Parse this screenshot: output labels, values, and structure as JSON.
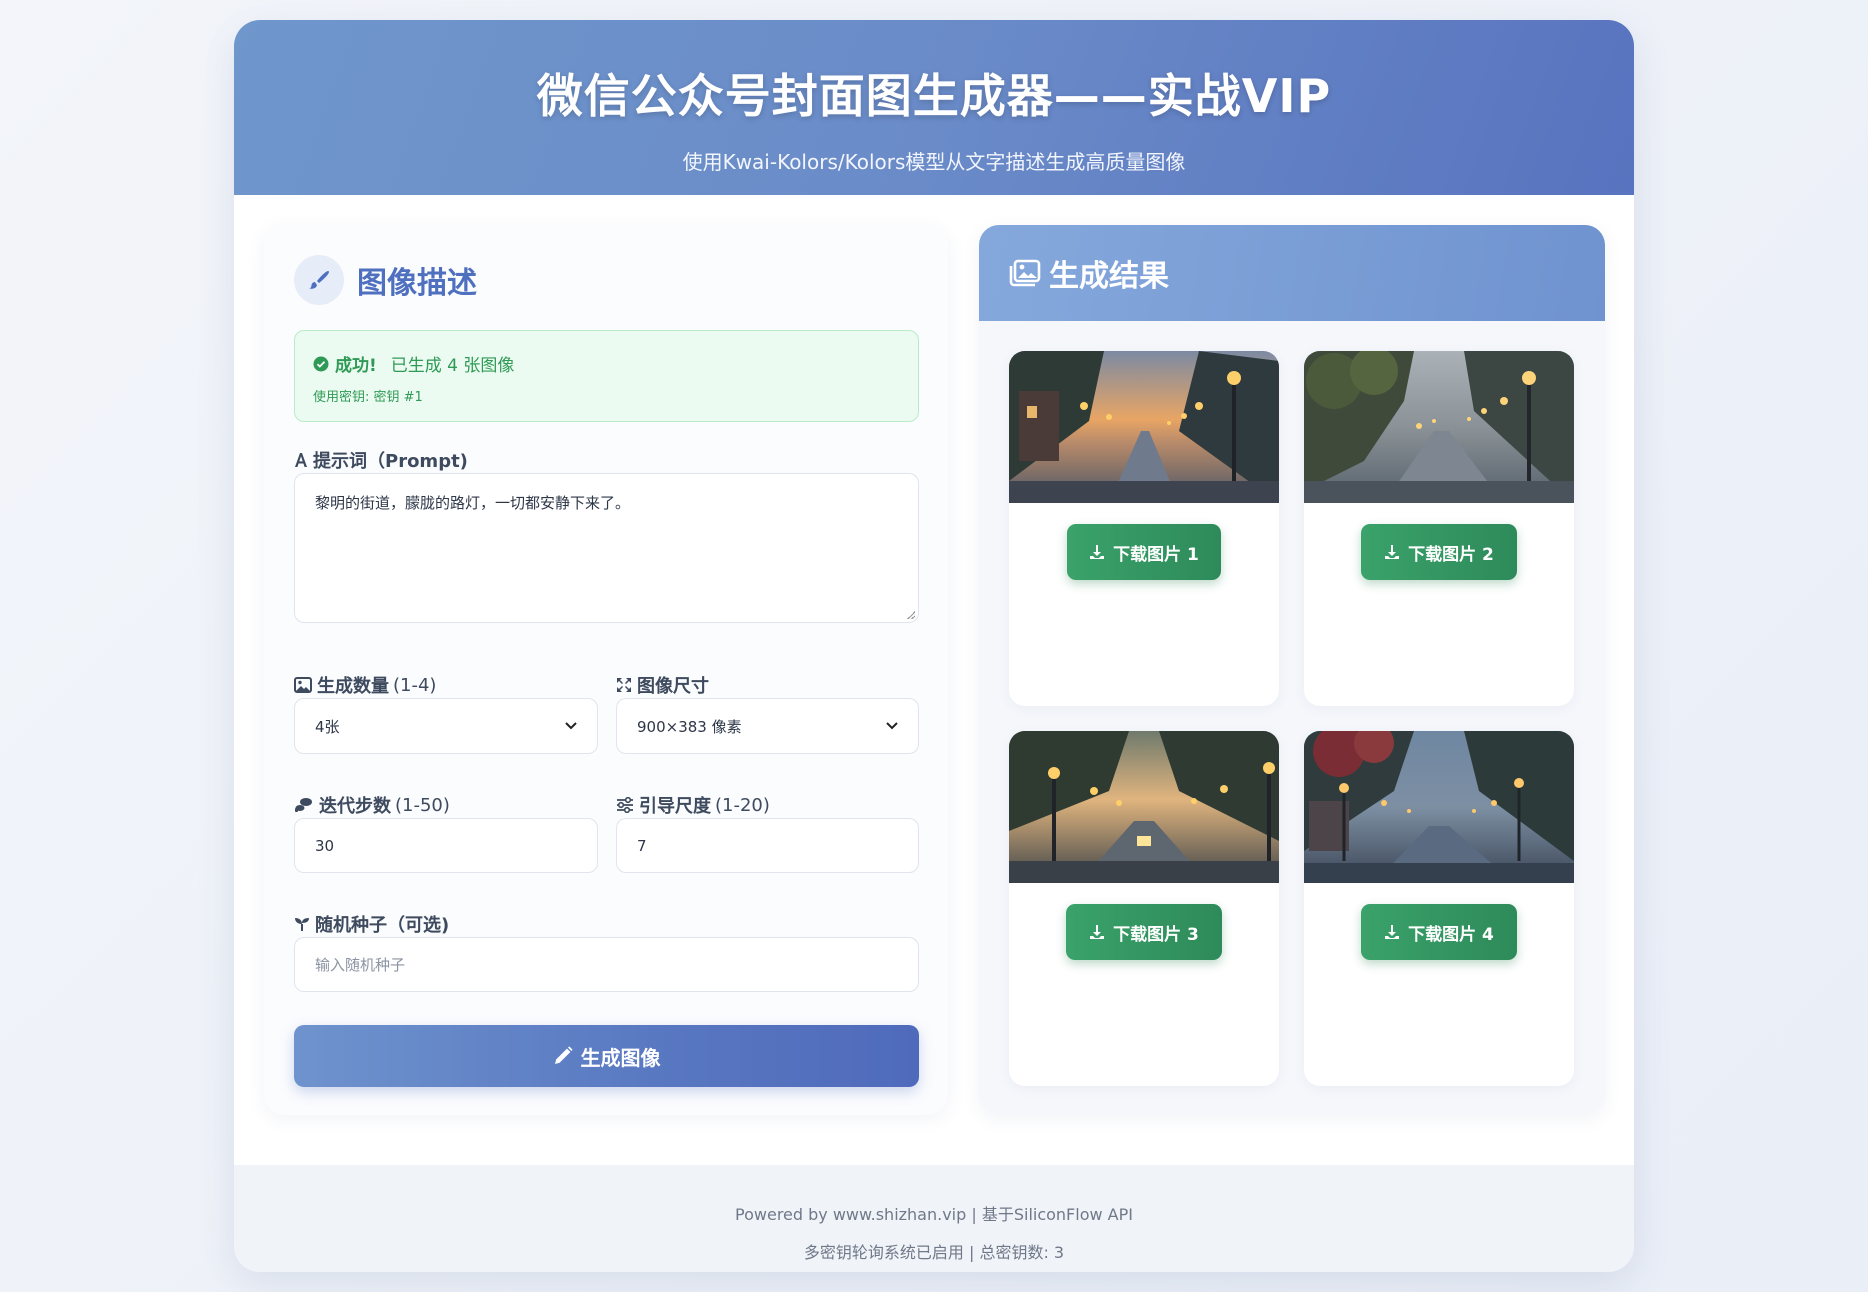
{
  "header": {
    "title": "微信公众号封面图生成器——实战VIP",
    "subtitle": "使用Kwai-Kolors/Kolors模型从文字描述生成高质量图像"
  },
  "form": {
    "section_title": "图像描述",
    "alert": {
      "status": "成功!",
      "message": "已生成 4 张图像",
      "key_info": "使用密钥: 密钥 #1",
      "color": "#2f9a55"
    },
    "prompt": {
      "label": "提示词（Prompt)",
      "value": "黎明的街道，朦胧的路灯，一切都安静下来了。"
    },
    "count": {
      "label": "生成数量",
      "range": "(1-4)",
      "selected": "4张"
    },
    "size": {
      "label": "图像尺寸",
      "selected": "900×383 像素"
    },
    "steps": {
      "label": "迭代步数",
      "range": "(1-50)",
      "value": "30"
    },
    "guidance": {
      "label": "引导尺度",
      "range": "(1-20)",
      "value": "7"
    },
    "seed": {
      "label": "随机种子（可选)",
      "placeholder": "输入随机种子"
    },
    "submit_label": "生成图像"
  },
  "results": {
    "title": "生成结果",
    "download_labels": [
      "下载图片 1",
      "下载图片 2",
      "下载图片 3",
      "下载图片 4"
    ]
  },
  "footer": {
    "line1": "Powered by www.shizhan.vip | 基于SiliconFlow API",
    "line2": "多密钥轮询系统已启用 | 总密钥数: 3"
  },
  "colors": {
    "accent": "#5a7bc4",
    "success": "#2f9a55",
    "download_button": "#3aa26a"
  }
}
